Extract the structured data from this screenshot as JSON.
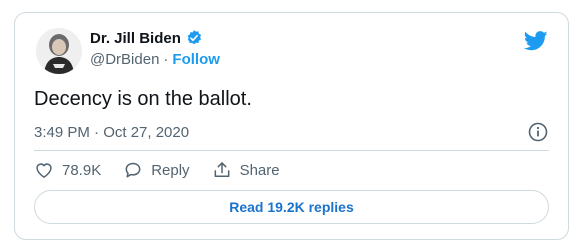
{
  "user": {
    "display_name": "Dr. Jill Biden",
    "handle": "@DrBiden",
    "separator": "·",
    "follow_label": "Follow"
  },
  "tweet": {
    "text": "Decency is on the ballot.",
    "timestamp": "3:49 PM · Oct 27, 2020"
  },
  "actions": {
    "likes": "78.9K",
    "reply_label": "Reply",
    "share_label": "Share"
  },
  "read_replies_label": "Read 19.2K replies",
  "colors": {
    "accent": "#1d9bf0",
    "text": "#0f1419",
    "muted": "#536471",
    "border": "#cfd9de"
  },
  "icons": [
    "avatar",
    "verified-badge-icon",
    "twitter-bird-icon",
    "info-icon",
    "heart-icon",
    "reply-icon",
    "share-icon"
  ]
}
